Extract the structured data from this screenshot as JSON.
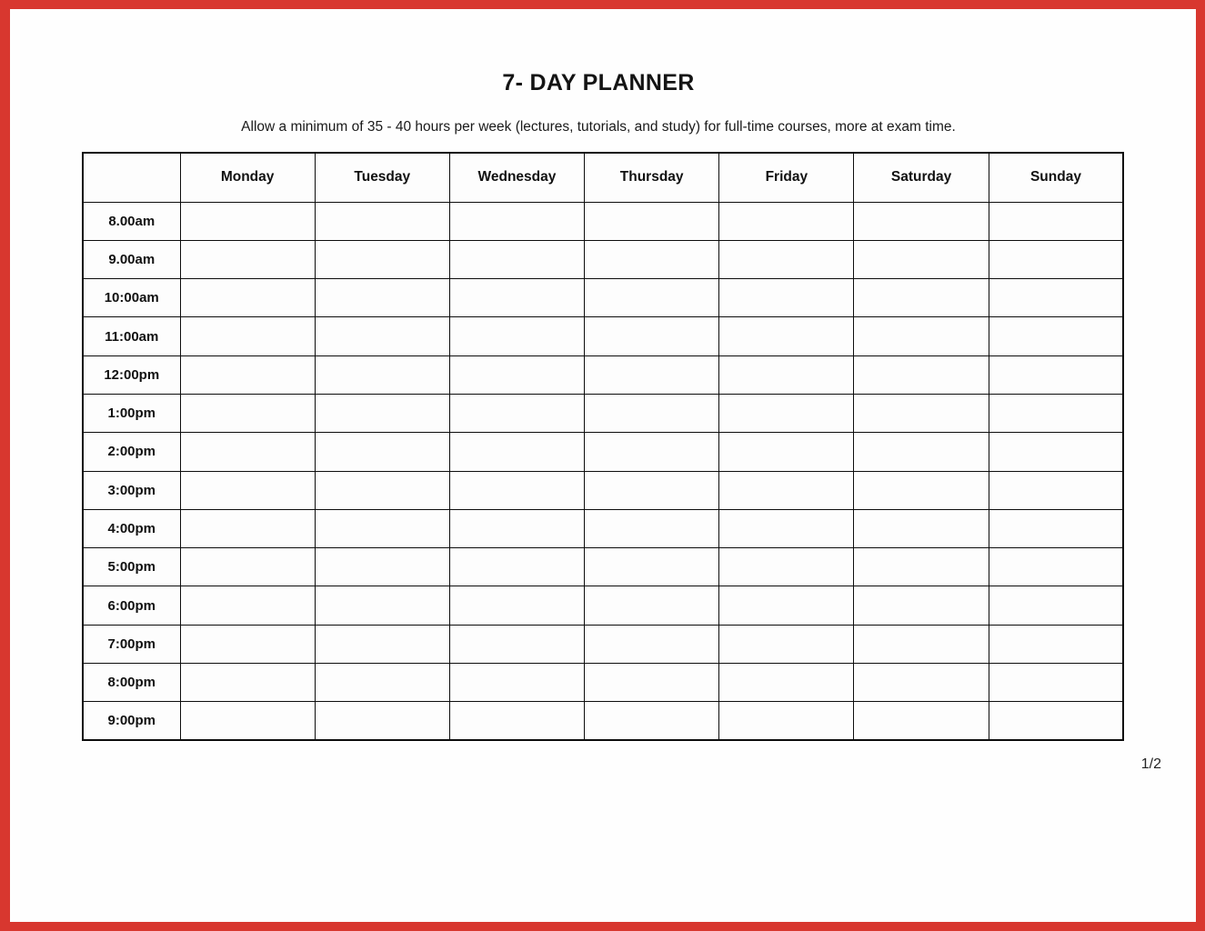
{
  "document": {
    "title": "7- DAY PLANNER",
    "subtitle": "Allow a minimum of 35 - 40 hours per week (lectures, tutorials, and study) for full-time courses, more at exam time.",
    "page_indicator": "1/2",
    "border_color": "#d8372f",
    "grid_color": "#0d0d0d",
    "paper_color": "#ffffff"
  },
  "table": {
    "corner_header": "",
    "day_headers": [
      "Monday",
      "Tuesday",
      "Wednesday",
      "Thursday",
      "Friday",
      "Saturday",
      "Sunday"
    ],
    "time_rows": [
      {
        "label": "8.00am",
        "cells": [
          "",
          "",
          "",
          "",
          "",
          "",
          ""
        ]
      },
      {
        "label": "9.00am",
        "cells": [
          "",
          "",
          "",
          "",
          "",
          "",
          ""
        ]
      },
      {
        "label": "10:00am",
        "cells": [
          "",
          "",
          "",
          "",
          "",
          "",
          ""
        ]
      },
      {
        "label": "11:00am",
        "cells": [
          "",
          "",
          "",
          "",
          "",
          "",
          ""
        ]
      },
      {
        "label": "12:00pm",
        "cells": [
          "",
          "",
          "",
          "",
          "",
          "",
          ""
        ]
      },
      {
        "label": "1:00pm",
        "cells": [
          "",
          "",
          "",
          "",
          "",
          "",
          ""
        ]
      },
      {
        "label": "2:00pm",
        "cells": [
          "",
          "",
          "",
          "",
          "",
          "",
          ""
        ]
      },
      {
        "label": "3:00pm",
        "cells": [
          "",
          "",
          "",
          "",
          "",
          "",
          ""
        ]
      },
      {
        "label": "4:00pm",
        "cells": [
          "",
          "",
          "",
          "",
          "",
          "",
          ""
        ]
      },
      {
        "label": "5:00pm",
        "cells": [
          "",
          "",
          "",
          "",
          "",
          "",
          ""
        ]
      },
      {
        "label": "6:00pm",
        "cells": [
          "",
          "",
          "",
          "",
          "",
          "",
          ""
        ]
      },
      {
        "label": "7:00pm",
        "cells": [
          "",
          "",
          "",
          "",
          "",
          "",
          ""
        ]
      },
      {
        "label": "8:00pm",
        "cells": [
          "",
          "",
          "",
          "",
          "",
          "",
          ""
        ]
      },
      {
        "label": "9:00pm",
        "cells": [
          "",
          "",
          "",
          "",
          "",
          "",
          ""
        ]
      }
    ]
  }
}
